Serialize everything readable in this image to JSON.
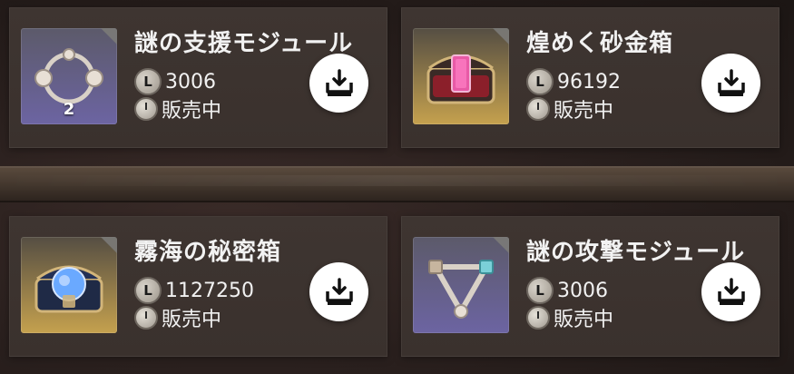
{
  "items": [
    {
      "title": "謎の支援モジュール",
      "quantity": "2",
      "price": "3006",
      "status": "販売中",
      "coin_letter": "L",
      "thumb_style": "purple",
      "thumb_icon": "ring-module-icon"
    },
    {
      "title": "煌めく砂金箱",
      "quantity": "",
      "price": "96192",
      "status": "販売中",
      "coin_letter": "L",
      "thumb_style": "gold",
      "thumb_icon": "gold-chest-icon"
    },
    {
      "title": "霧海の秘密箱",
      "quantity": "",
      "price": "1127250",
      "status": "販売中",
      "coin_letter": "L",
      "thumb_style": "gold",
      "thumb_icon": "blue-chest-icon"
    },
    {
      "title": "謎の攻撃モジュール",
      "quantity": "",
      "price": "3006",
      "status": "販売中",
      "coin_letter": "L",
      "thumb_style": "purple",
      "thumb_icon": "triangle-module-icon"
    }
  ],
  "colors": {
    "card_bg": "#3e3531",
    "text": "#f2f2f2",
    "button_bg": "#ffffff"
  }
}
